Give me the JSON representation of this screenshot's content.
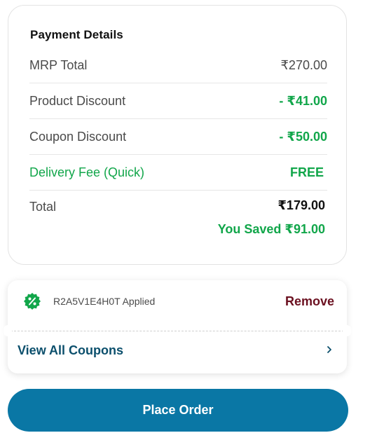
{
  "payment": {
    "title": "Payment Details",
    "rows": [
      {
        "label": "MRP Total",
        "value": "₹270.00"
      },
      {
        "label": "Product Discount",
        "value": "- ₹41.00"
      },
      {
        "label": "Coupon Discount",
        "value": "- ₹50.00"
      },
      {
        "label": "Delivery Fee (Quick)",
        "value": "FREE"
      }
    ],
    "total_label": "Total",
    "total_value": "₹179.00",
    "saved_text": "You Saved ₹91.00"
  },
  "coupon": {
    "applied_text": "R2A5V1E4H0T Applied",
    "remove_label": "Remove",
    "view_all_label": "View All Coupons",
    "icon": "discount-badge-icon"
  },
  "actions": {
    "place_order_label": "Place Order"
  },
  "colors": {
    "green": "#11a64a",
    "primary": "#0a77a5",
    "remove": "#6b1020",
    "link": "#0b4f6c"
  }
}
